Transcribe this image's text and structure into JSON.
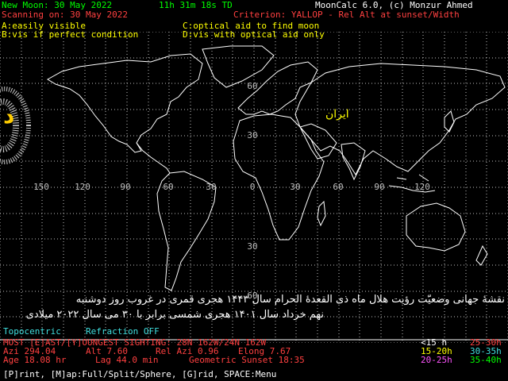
{
  "header": {
    "new_moon": "New Moon: 30 May 2022",
    "time": "11h 31m 18s TD",
    "app": "MoonCalc 6.0, (c) Monzur Ahmed",
    "scanning": "Scanning on: 30 May 2022",
    "criterion": "Criterion: YALLOP - Rel Alt at sunset/Width"
  },
  "legend_top": {
    "a": "A:easily visible",
    "b": "B:vis if perfect condition",
    "c": "C:optical aid to find moon",
    "d": "D:vis with optical aid only"
  },
  "map": {
    "longitudes": [
      "150",
      "120",
      "90",
      "60",
      "30",
      "0",
      "30",
      "60",
      "90",
      "120"
    ],
    "latitudes": [
      "60",
      "30",
      "30",
      "60"
    ],
    "region_label": "ایران",
    "moon_letter": "د",
    "colors": {
      "grid": "#bfbfbf",
      "coast": "#ffffff",
      "zone": "#ffff00",
      "zone_dots": "#c8c8c8"
    }
  },
  "farsi": {
    "line1": "نقشهٔ جهانی وضعیّت رؤیت هلال ماه ذی القعدهٔ الحرام سال ۱۴۴۳ هجری قمری در غروب روز دوشنبه",
    "line2": "نهم خرداد سال ۱۴۰۱ هجری شمسی برابر با ۳۰ می سال ۲۰۲۲ میلادی"
  },
  "status": {
    "topocentric": "Topocentric",
    "refraction": "Refraction OFF",
    "sighting": "MOST [E]AST/[Y]OUNGEST SIGHTING: 28N 162W/24N 162W",
    "azi": "Azi 294.04",
    "alt": "Alt 7.60",
    "rel_azi": "Rel Azi 0.96",
    "elong": "Elong 7.67",
    "age": "Age 18.08 hr",
    "lag": "Lag 44.0 min",
    "sunset": "Geometric Sunset 18:35"
  },
  "age_legend": {
    "lt15": "<15 h",
    "r25_30": "25-30h",
    "r15_20": "15-20h",
    "r30_35": "30-35h",
    "r20_25": "20-25h",
    "r35_40": "35-40h"
  },
  "footer": {
    "keys": "[P]rint, [M]ap:Full/Split/Sphere, [G]rid, SPACE:Menu"
  }
}
